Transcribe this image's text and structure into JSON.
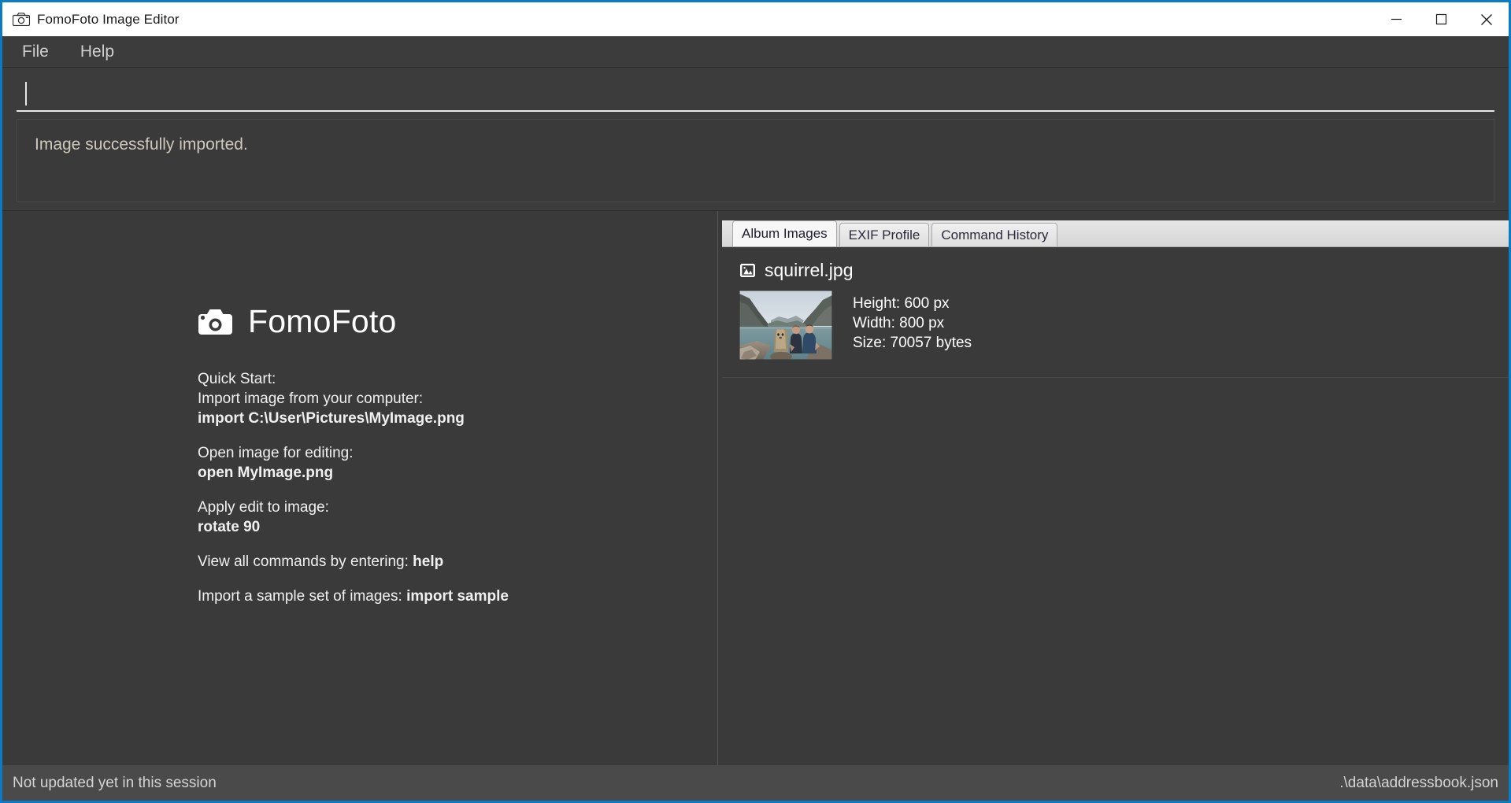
{
  "window": {
    "title": "FomoFoto Image Editor",
    "title_icon": "camera-icon",
    "accent_color": "#0a7bc4",
    "background_color": "#3a3a3a",
    "controls": {
      "minimize": "minimize-icon",
      "maximize": "maximize-icon",
      "close": "close-icon"
    }
  },
  "menubar": {
    "items": [
      {
        "label": "File"
      },
      {
        "label": "Help"
      }
    ]
  },
  "command": {
    "value": "",
    "placeholder": "",
    "caret_visible": true
  },
  "result": {
    "text": "Image successfully imported."
  },
  "welcome": {
    "brand_icon": "camera-icon",
    "brand_name": "FomoFoto",
    "lines": [
      {
        "text": "Quick Start:",
        "bold": false,
        "gap_before": false
      },
      {
        "text": "Import image from your computer:",
        "bold": false,
        "gap_before": false
      },
      {
        "text": "import C:\\User\\Pictures\\MyImage.png",
        "bold": true,
        "gap_before": false
      },
      {
        "text": "Open image for editing:",
        "bold": false,
        "gap_before": true
      },
      {
        "text": "open MyImage.png",
        "bold": true,
        "gap_before": false
      },
      {
        "text": "Apply edit to image:",
        "bold": false,
        "gap_before": true
      },
      {
        "text": "rotate 90",
        "bold": true,
        "gap_before": false
      }
    ],
    "help_line": {
      "prefix": "View all commands by entering: ",
      "command": "help"
    },
    "sample_line": {
      "prefix": "Import a sample set of images: ",
      "command": "import sample"
    }
  },
  "tabs": {
    "items": [
      {
        "label": "Album Images",
        "active": true
      },
      {
        "label": "EXIF Profile",
        "active": false
      },
      {
        "label": "Command History",
        "active": false
      }
    ]
  },
  "album": {
    "images": [
      {
        "icon": "picture-frame-icon",
        "filename": "squirrel.jpg",
        "thumbnail_alt": "squirrel-photobomb-lake-thumbnail",
        "meta": [
          "Height: 600 px",
          "Width: 800 px",
          "Size: 70057 bytes"
        ]
      }
    ]
  },
  "statusbar": {
    "left": "Not updated yet in this session",
    "right": ".\\data\\addressbook.json"
  }
}
